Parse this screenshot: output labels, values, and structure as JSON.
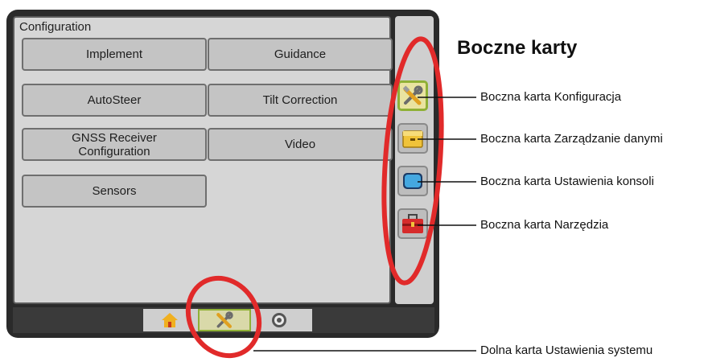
{
  "config_panel": {
    "title": "Configuration",
    "buttons": [
      {
        "line1": "Implement",
        "line2": ""
      },
      {
        "line1": "Guidance",
        "line2": ""
      },
      {
        "line1": "AutoSteer",
        "line2": ""
      },
      {
        "line1": "Tilt Correction",
        "line2": ""
      },
      {
        "line1": "GNSS Receiver",
        "line2": "Configuration"
      },
      {
        "line1": "Video",
        "line2": ""
      },
      {
        "line1": "Sensors",
        "line2": ""
      }
    ]
  },
  "side_tabs": [
    {
      "name": "configuration",
      "icon": "tools-icon",
      "active": true,
      "color": "#e9e3a0"
    },
    {
      "name": "data-management",
      "icon": "folder-icon",
      "active": false,
      "color": "#f0c33a"
    },
    {
      "name": "console-settings",
      "icon": "display-icon",
      "active": false,
      "color": "#45a8e0"
    },
    {
      "name": "tools",
      "icon": "toolbox-icon",
      "active": false,
      "color": "#d62b2b"
    }
  ],
  "bottom_tabs": [
    {
      "name": "home",
      "icon": "home-icon",
      "active": false
    },
    {
      "name": "system-setup",
      "icon": "tools-icon",
      "active": true
    },
    {
      "name": "guidance-view",
      "icon": "target-icon",
      "active": false
    }
  ],
  "annotations": {
    "heading": "Boczne karty",
    "callouts": [
      "Boczna karta Konfiguracja",
      "Boczna karta Zarządzanie danymi",
      "Boczna karta Ustawienia konsoli",
      "Boczna karta Narzędzia",
      "Dolna karta Ustawienia systemu"
    ]
  },
  "colors": {
    "highlight_ring": "#e12a2a",
    "active_outline": "#8fb036",
    "screen_frame": "#2a2a2a"
  }
}
